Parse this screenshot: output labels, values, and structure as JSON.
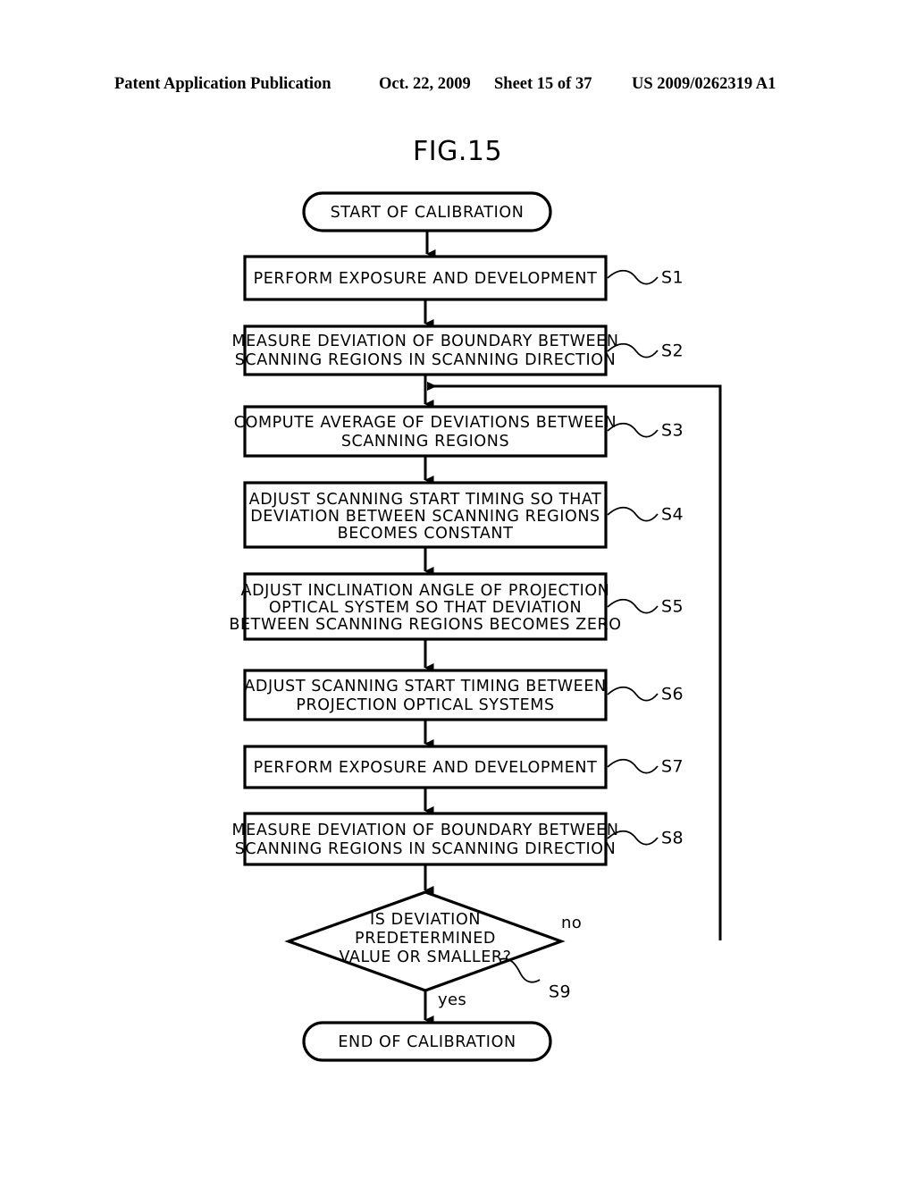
{
  "header": {
    "publication": "Patent Application Publication",
    "date": "Oct. 22, 2009",
    "sheet": "Sheet 15 of 37",
    "patent_number": "US 2009/0262319 A1"
  },
  "figure": {
    "title": "FIG.15"
  },
  "flowchart": {
    "start": {
      "label": "START OF CALIBRATION"
    },
    "end": {
      "label": "END OF CALIBRATION"
    },
    "steps": [
      {
        "id": "S1",
        "lines": [
          "PERFORM EXPOSURE AND DEVELOPMENT"
        ]
      },
      {
        "id": "S2",
        "lines": [
          "MEASURE DEVIATION OF BOUNDARY BETWEEN",
          "SCANNING REGIONS IN SCANNING DIRECTION"
        ]
      },
      {
        "id": "S3",
        "lines": [
          "COMPUTE AVERAGE OF DEVIATIONS BETWEEN",
          "SCANNING REGIONS"
        ]
      },
      {
        "id": "S4",
        "lines": [
          "ADJUST SCANNING START TIMING SO THAT",
          "DEVIATION BETWEEN SCANNING REGIONS",
          "BECOMES CONSTANT"
        ]
      },
      {
        "id": "S5",
        "lines": [
          "ADJUST INCLINATION ANGLE OF PROJECTION",
          "OPTICAL SYSTEM SO THAT DEVIATION",
          "BETWEEN SCANNING REGIONS BECOMES ZERO"
        ]
      },
      {
        "id": "S6",
        "lines": [
          "ADJUST SCANNING START TIMING BETWEEN",
          "PROJECTION OPTICAL SYSTEMS"
        ]
      },
      {
        "id": "S7",
        "lines": [
          "PERFORM EXPOSURE AND DEVELOPMENT"
        ]
      },
      {
        "id": "S8",
        "lines": [
          "MEASURE DEVIATION OF BOUNDARY BETWEEN",
          "SCANNING REGIONS IN SCANNING DIRECTION"
        ]
      }
    ],
    "decision": {
      "id": "S9",
      "lines": [
        "IS DEVIATION",
        "PREDETERMINED",
        "VALUE OR SMALLER?"
      ],
      "yes_label": "yes",
      "no_label": "no"
    }
  }
}
